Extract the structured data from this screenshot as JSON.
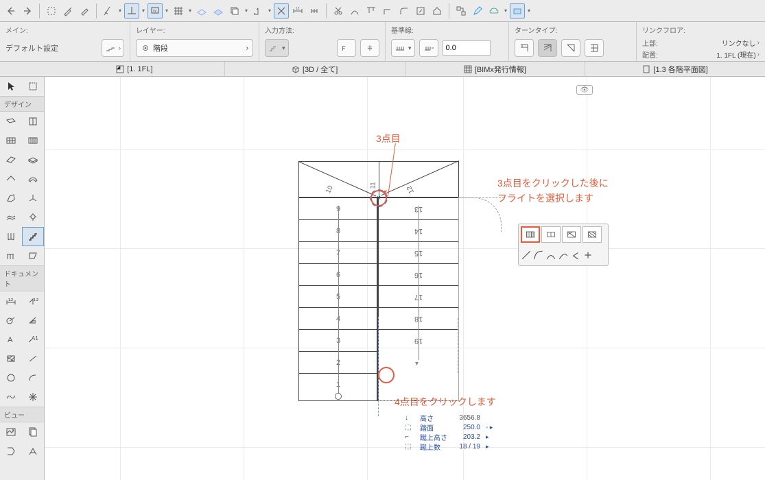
{
  "optbar": {
    "main_label": "メイン:",
    "main_value": "デフォルト設定",
    "layer_label": "レイヤー:",
    "layer_value": "階段",
    "input_label": "入力方法:",
    "baseline_label": "基準線:",
    "baseline_value": "0.0",
    "turn_label": "ターンタイプ:",
    "link_label": "リンクフロア:",
    "link_top_label": "上部:",
    "link_top_value": "リンクなし",
    "link_pos_label": "配置:",
    "link_pos_value": "1. 1FL (現在)"
  },
  "tabs": {
    "t1": "[1. 1FL]",
    "t2": "[3D / 全て]",
    "t3": "[BIMx発行情報]",
    "t4": "[1.3 各階平面図]"
  },
  "left_headers": {
    "design": "デザイン",
    "document": "ドキュメント",
    "view": "ビュー"
  },
  "annotations": {
    "point3": "3点目",
    "instr1": "3点目をクリックした後に",
    "instr2": "フライトを選択します",
    "point4": "4点目をクリックします"
  },
  "info": {
    "height_label": "高さ",
    "height_val": "3656.8",
    "tread_label": "踏面",
    "tread_val": "250.0",
    "riser_label": "蹴上高さ",
    "riser_val": "203.2",
    "count_label": "蹴上数",
    "count_val": "18 / 19"
  },
  "stair_left": [
    "9",
    "8",
    "7",
    "6",
    "5",
    "4",
    "3",
    "2",
    "1"
  ],
  "stair_right": [
    "13",
    "14",
    "15",
    "16",
    "17",
    "18",
    "19"
  ],
  "stair_top": [
    "10",
    "11",
    "12"
  ]
}
